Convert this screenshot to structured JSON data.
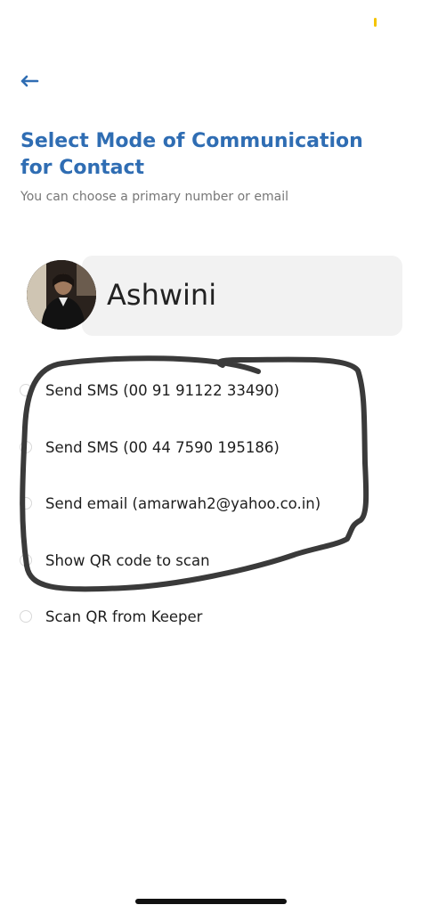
{
  "header": {
    "back_icon": "arrow-left-icon",
    "title": "Select Mode of Communication for Contact",
    "subtitle": "You can choose a primary number or email"
  },
  "contact": {
    "name": "Ashwini",
    "avatar_icon": "avatar-photo"
  },
  "options": [
    {
      "label": "Send SMS (00 91 91122 33490)",
      "selected": false
    },
    {
      "label": "Send SMS (00 44 7590 195186)",
      "selected": false
    },
    {
      "label": "Send email (amarwah2@yahoo.co.in)",
      "selected": false
    },
    {
      "label": "Show QR code to scan",
      "selected": false
    },
    {
      "label": "Scan QR from Keeper",
      "selected": false
    }
  ],
  "colors": {
    "accent": "#2f6db3",
    "card_bg": "#f2f2f2",
    "scribble": "#3a3a3a"
  }
}
